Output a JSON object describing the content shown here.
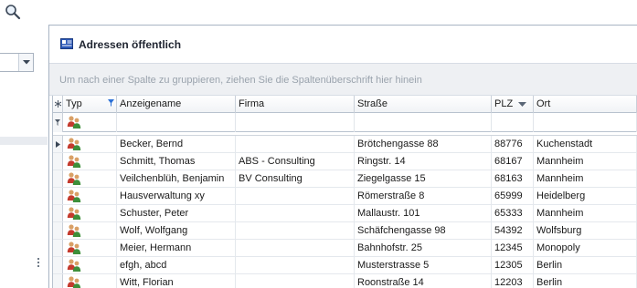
{
  "colors": {
    "accent": "#1e3f8a",
    "header_bg": "#f1f3f6",
    "group_bg": "#eef0f3",
    "border": "#b8c2ce"
  },
  "icons": {
    "toolbar_search": "search-icon",
    "panel": "address-book-icon",
    "row_type": "contact-people-icon",
    "combo": "chevron-down-icon",
    "filter": "filter-icon",
    "sort": "sort-descending-icon",
    "row_indicator": "row-pointer-icon"
  },
  "panel": {
    "title": "Adressen öffentlich"
  },
  "group_panel": {
    "hint": "Um nach einer Spalte zu gruppieren, ziehen Sie die Spaltenüberschrift hier hinein"
  },
  "grid": {
    "columns": [
      "Typ",
      "Anzeigename",
      "Firma",
      "Straße",
      "PLZ",
      "Ort"
    ],
    "sorted_column": "PLZ",
    "sort_direction": "descending",
    "filtered_column": "Typ",
    "rows": [
      {
        "anzeigename": "Becker, Bernd",
        "firma": "",
        "strasse": "Brötchengasse 88",
        "plz": "88776",
        "ort": "Kuchenstadt",
        "current": true
      },
      {
        "anzeigename": "Schmitt, Thomas",
        "firma": "ABS - Consulting",
        "strasse": "Ringstr. 14",
        "plz": "68167",
        "ort": "Mannheim"
      },
      {
        "anzeigename": "Veilchenblüh, Benjamin",
        "firma": "BV Consulting",
        "strasse": "Ziegelgasse 15",
        "plz": "68163",
        "ort": "Mannheim"
      },
      {
        "anzeigename": "Hausverwaltung xy",
        "firma": "",
        "strasse": "Römerstraße 8",
        "plz": "65999",
        "ort": "Heidelberg"
      },
      {
        "anzeigename": "Schuster, Peter",
        "firma": "",
        "strasse": "Mallaustr. 101",
        "plz": "65333",
        "ort": "Mannheim"
      },
      {
        "anzeigename": "Wolf, Wolfgang",
        "firma": "",
        "strasse": "Schäfchengasse 98",
        "plz": "54392",
        "ort": "Wolfsburg"
      },
      {
        "anzeigename": "Meier, Hermann",
        "firma": "",
        "strasse": "Bahnhofstr. 25",
        "plz": "12345",
        "ort": "Monopoly"
      },
      {
        "anzeigename": "efgh, abcd",
        "firma": "",
        "strasse": "Musterstrasse 5",
        "plz": "12305",
        "ort": "Berlin"
      },
      {
        "anzeigename": "Witt, Florian",
        "firma": "",
        "strasse": "Roonstraße 14",
        "plz": "12203",
        "ort": "Berlin"
      }
    ]
  }
}
